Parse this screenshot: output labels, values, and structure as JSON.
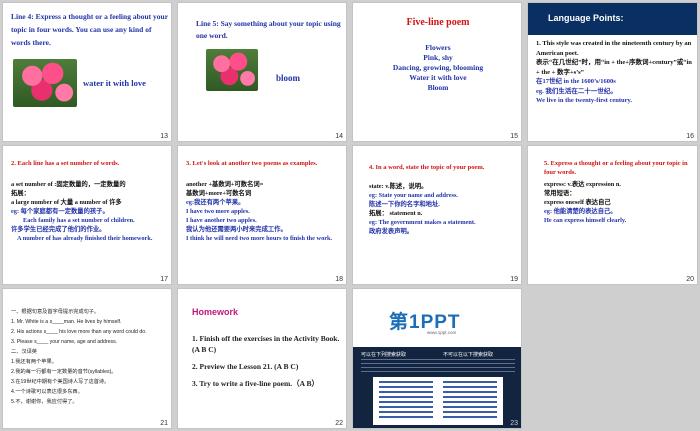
{
  "slides": {
    "s13": {
      "title": "Line 4: Express a thought or a feeling about your topic in four words. You can use any kind of words there.",
      "caption": "water it with love",
      "number": "13"
    },
    "s14": {
      "title": "Line 5: Say something about your topic using one word.",
      "caption": "bloom",
      "number": "14"
    },
    "s15": {
      "title": "Five-line poem",
      "lines": [
        "Flowers",
        "Pink, shy",
        "Dancing, growing, blooming",
        "Water it with love",
        "Bloom"
      ],
      "number": "15"
    },
    "s16": {
      "header": "Language Points:",
      "p1": "1. This style was created in the nineteenth century by an American poet.",
      "p2": "表示“在几世纪”时，用“in + the+序数词+century”或“in + the + 数字+s’s”",
      "p3": "在17世纪 in the 1600’s/1600s",
      "p4": "eg. 我们生活在二十一世纪。",
      "p5": "We live in the twenty-first century.",
      "number": "16"
    },
    "s17": {
      "title": "2. Each line has a set number of words.",
      "l1": "a set number of :固定数量的，一定数量的",
      "l2": "拓展：",
      "l3": "a large number of 大量   a number of 许多",
      "l4": "eg:  每个家庭都有一定数量的孩子。",
      "l5": "Each family has a set number of children.",
      "l6": "许多学生已经完成了他们的作业。",
      "l7": "A number of has already finished their homework.",
      "number": "17"
    },
    "s18": {
      "title": "3. Let's look at another two poems as examples.",
      "l1": "another +基数词+可数名词=",
      "l2": "基数词+more+可数名词",
      "l3": "eg:我还有两个苹果。",
      "l4": "I have two more apples.",
      "l5": "I have another two apples.",
      "l6": "我认为他还需要两小时来完成工作。",
      "l7": "I think he will need two more hours to finish the work.",
      "number": "18"
    },
    "s19": {
      "title": "4. In a word,  state the topic of your poem.",
      "l1": "state: v.陈述，说明。",
      "l2": "eg: State your name and address.",
      "l3": "陈述一下你的名字和地址.",
      "l4": "拓展： statement  n.",
      "l5": "eg: The government makes a statement.",
      "l6": "政府发表声明。",
      "number": "19"
    },
    "s20": {
      "title": "5. Express a thought or a feeling about your topic in four words.",
      "l1": "express: v.表达   expression  n.",
      "l2": "常用短语：",
      "l3": "express oneself  表达自己",
      "l4": "eg: 他能清楚的表达自己。",
      "l5": "He can express himself clearly.",
      "number": "20"
    },
    "s21": {
      "lines": [
        "一、根据句意及首字母提示完成句子。",
        "1. Mr. White is a s____man. He lives by himself.",
        "2. His actions s____ his love more than any word could do.",
        "3. Please s____ your name, age and address.",
        "二、汉译英",
        "1.我还有两个苹果。",
        "2.我的每一行都有一定数量的音节(syllables)。",
        "3.在19世纪中期有个美国诗人写了这首诗。",
        "4.一个诗歌可以表达很多东西。",
        "5.不，谢谢你，我应付得了。"
      ],
      "number": "21"
    },
    "s22": {
      "title": "Homework",
      "items": [
        "1. Finish off the exercises in the Activity Book. (A B C)",
        "2. Preview the Lesson 21. (A B C)",
        "3. Try to write a five-line poem.（A B）"
      ],
      "number": "22"
    },
    "s23": {
      "logo": "第1PPT",
      "sub": "www.1ppt.com",
      "panel_left_title": "可以在下列搜索获取",
      "panel_right_title": "不可以在以下搜索获取",
      "number": "23"
    }
  }
}
